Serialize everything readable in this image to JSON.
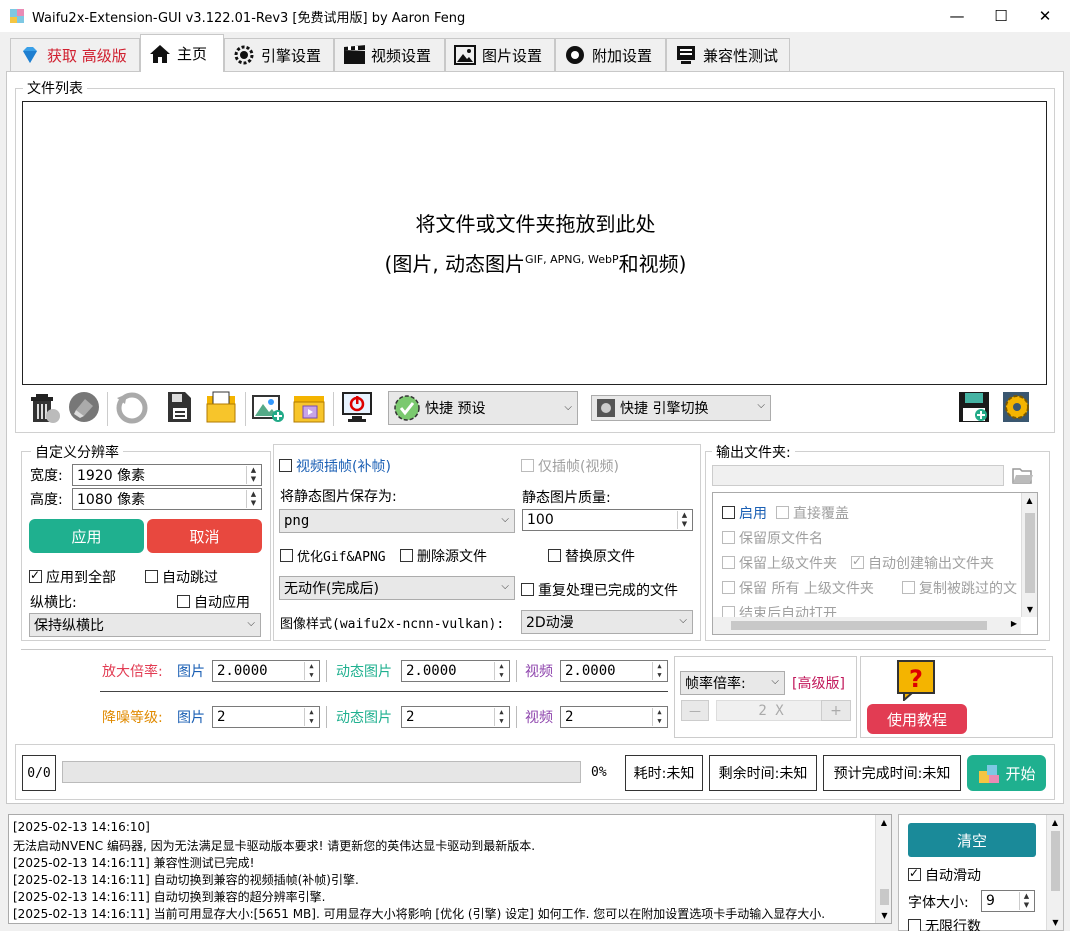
{
  "window": {
    "title": "Waifu2x-Extension-GUI v3.122.01-Rev3 [免费试用版] by Aaron Feng",
    "minimize": "—",
    "maximize": "☐",
    "close": "✕"
  },
  "tabs": [
    {
      "label": "获取  高级版",
      "icon": "diamond-icon"
    },
    {
      "label": "主页",
      "icon": "home-icon"
    },
    {
      "label": "引擎设置",
      "icon": "engine-icon"
    },
    {
      "label": "视频设置",
      "icon": "film-icon"
    },
    {
      "label": "图片设置",
      "icon": "image-icon"
    },
    {
      "label": "附加设置",
      "icon": "settings-icon"
    },
    {
      "label": "兼容性测试",
      "icon": "test-icon"
    }
  ],
  "file_list": {
    "legend": "文件列表",
    "drop_line1": "将文件或文件夹拖放到此处",
    "drop_line2_prefix": "(图片, 动态图片",
    "drop_line2_sup": "GIF, APNG, WebP",
    "drop_line2_suffix": "和视频)"
  },
  "toolbar": {
    "preset_combo": "快捷 预设",
    "engine_combo": "快捷 引擎切换"
  },
  "custom_res": {
    "legend": "自定义分辨率",
    "width_label": "宽度:",
    "width_value": "1920 像素",
    "height_label": "高度:",
    "height_value": "1080 像素",
    "apply": "应用",
    "cancel": "取消",
    "apply_all": "应用到全部",
    "auto_skip": "自动跳过",
    "aspect_label": "纵横比:",
    "auto_apply": "自动应用",
    "aspect_value": "保持纵横比"
  },
  "middle": {
    "video_interp": "视频插帧(补帧)",
    "interp_only": "仅插帧(视频)",
    "save_as_label": "将静态图片保存为:",
    "save_as_value": "png",
    "quality_label": "静态图片质量:",
    "quality_value": "100",
    "optimize_gif": "优化Gif&APNG",
    "delete_source": "删除源文件",
    "replace_source": "替换原文件",
    "after_action": "无动作(完成后)",
    "reprocess": "重复处理已完成的文件",
    "style_label": "图像样式(waifu2x-ncnn-vulkan):",
    "style_value": "2D动漫"
  },
  "output": {
    "legend": "输出文件夹:",
    "enable": "启用",
    "overwrite": "直接覆盖",
    "keep_name": "保留原文件名",
    "keep_parent": "保留上级文件夹",
    "auto_create": "自动创建输出文件夹",
    "keep_all": "保留  所有  上级文件夹",
    "copy_skipped": "复制被跳过的文",
    "auto_open": "结束后自动打开"
  },
  "scale": {
    "scale_label": "放大倍率:",
    "denoise_label": "降噪等级:",
    "image": "图片",
    "anim": "动态图片",
    "video": "视频",
    "scale_image": "2.0000",
    "scale_anim": "2.0000",
    "scale_video": "2.0000",
    "denoise_image": "2",
    "denoise_anim": "2",
    "denoise_video": "2",
    "fps_label": "帧率倍率:",
    "premium": "[高级版]",
    "minus": "—",
    "fps_value": "2 X",
    "plus": "+",
    "tutorial": "使用教程"
  },
  "progress": {
    "count": "0/0",
    "percent": "0%",
    "elapsed": "耗时:未知",
    "remaining": "剩余时间:未知",
    "eta": "预计完成时间:未知",
    "start": "开始",
    "fill": 0
  },
  "log": [
    "[2025-02-13 14:16:10]",
    "无法启动NVENC 编码器, 因为无法满足显卡驱动版本要求! 请更新您的英伟达显卡驱动到最新版本.",
    "[2025-02-13 14:16:11] 兼容性测试已完成!",
    "[2025-02-13 14:16:11] 自动切换到兼容的视频插帧(补帧)引擎.",
    "[2025-02-13 14:16:11] 自动切换到兼容的超分辨率引擎.",
    "[2025-02-13 14:16:11] 当前可用显存大小:[5651 MB]. 可用显存大小将影响 [优化 (引擎) 设定] 如何工作. 您可以在附加设置选项卡手动输入显存大小."
  ],
  "log_panel": {
    "clear": "清空",
    "auto_scroll": "自动滑动",
    "font_size_label": "字体大小:",
    "font_size_value": "9",
    "unlimited": "无限行数"
  },
  "colors": {
    "teal": "#1fb08f",
    "red": "#e8483f",
    "pink": "#e23c53",
    "magenta": "#c2185b",
    "orange": "#e08a00",
    "purple": "#8e44ad"
  }
}
